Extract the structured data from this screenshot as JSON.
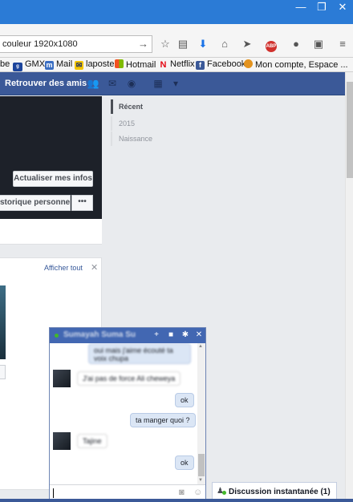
{
  "browser": {
    "window_controls": {
      "minimize": "—",
      "maximize": "❐",
      "close": "✕"
    },
    "url": "couleur 1920x1080",
    "toolbar_icons": [
      "star-icon",
      "reading-list-icon",
      "download-icon",
      "home-icon",
      "send-icon",
      "adblock-icon",
      "chat-icon",
      "pocket-icon",
      "menu-icon"
    ],
    "adblock_label": "ABP"
  },
  "bookmarks": [
    {
      "label": "be",
      "icon": ""
    },
    {
      "label": "GMX",
      "icon": "gmx"
    },
    {
      "label": "Mail",
      "icon": "m"
    },
    {
      "label": "laposte",
      "icon": "laposte"
    },
    {
      "label": "Hotmail",
      "icon": "windows"
    },
    {
      "label": "Netflix",
      "icon": "N"
    },
    {
      "label": "Facebook",
      "icon": "f"
    },
    {
      "label": "Mon compte, Espace ...",
      "icon": "bouygues"
    }
  ],
  "fb": {
    "find_friends": "Retrouver des amis",
    "update_info": "Actualiser mes infos",
    "history": "storique personnel",
    "more": "•••",
    "timeline": [
      "Récent",
      "2015",
      "Naissance"
    ],
    "photos": {
      "show_all": "Afficher tout",
      "close": "✕"
    }
  },
  "chat": {
    "contact_name": "Sumayah Suma Su",
    "messages": [
      {
        "from": "me",
        "text": "oui mais j'aime écouté ta voix chupa",
        "blurred": true
      },
      {
        "from": "them",
        "text": "J'ai pas de force Ali cheweya",
        "blurred": true
      },
      {
        "from": "me",
        "text": "ok",
        "blurred": false
      },
      {
        "from": "me",
        "text": "ta manger quoi ?",
        "blurred": false
      },
      {
        "from": "them",
        "text": "Tajine",
        "blurred": true
      },
      {
        "from": "me",
        "text": "ok",
        "blurred": false
      }
    ],
    "input_value": ""
  },
  "discussion": {
    "label": "Discussion instantanée (1)"
  },
  "colors": {
    "fb_blue": "#3b5998",
    "chat_head": "#4267b2",
    "online": "#42b72a"
  }
}
